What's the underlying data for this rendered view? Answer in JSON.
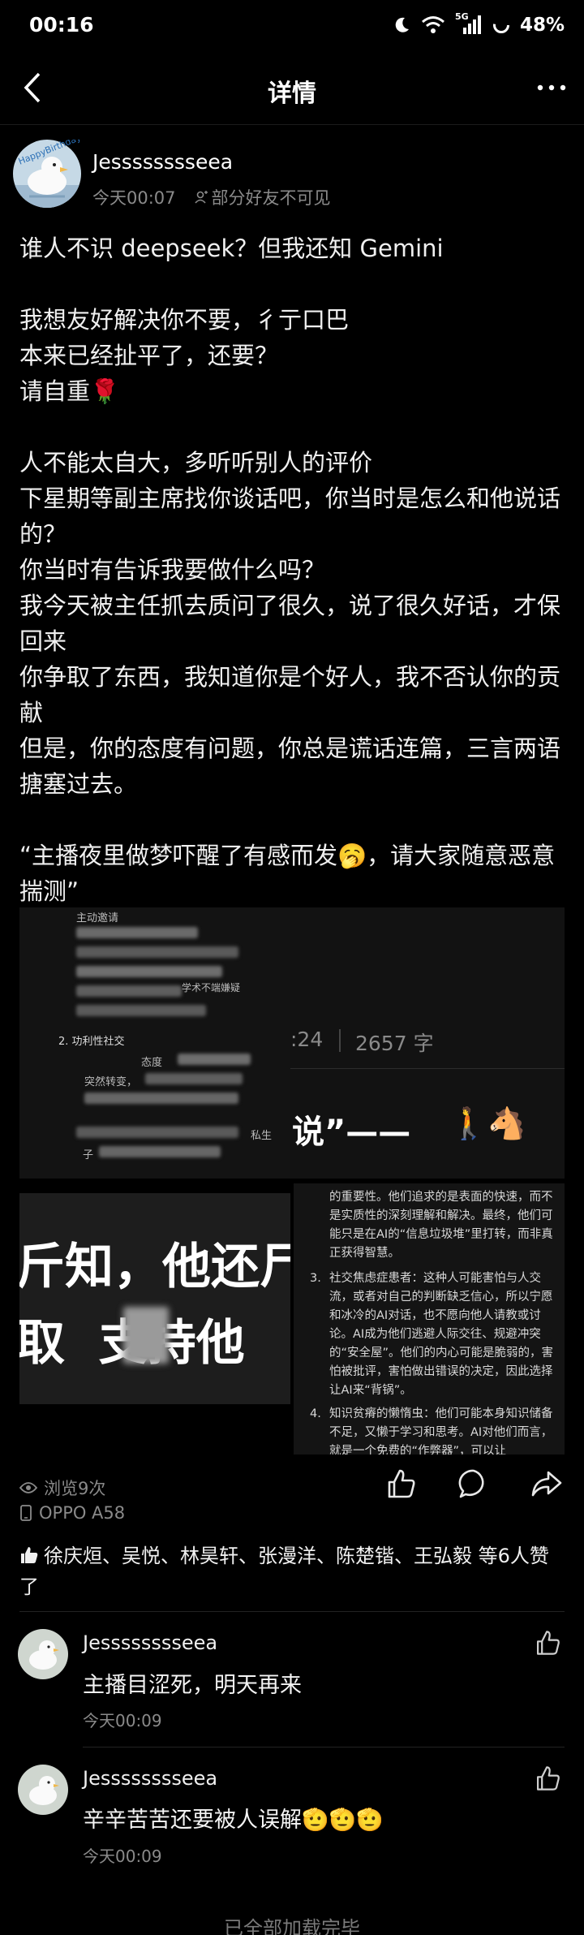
{
  "status_bar": {
    "time": "00:16",
    "network": "5G",
    "battery_text": "48%",
    "icons": [
      "moon-icon",
      "wifi-icon",
      "signal-icon",
      "battery-icon"
    ]
  },
  "nav": {
    "title": "详情",
    "back_icon": "chevron-left-icon",
    "more_icon": "more-dots-icon"
  },
  "post": {
    "author": "Jesssssssseea",
    "avatar_text": "HappyBirthday",
    "time": "今天00:07",
    "visibility": "部分好友不可见",
    "body": [
      "谁人不识 deepseek？但我还知 Gemini",
      "",
      "我想友好解决你不要，彳亍口巴",
      "本来已经扯平了，还要？",
      "请自重🌹",
      "",
      "人不能太自大，多听听别人的评价",
      "下星期等副主席找你谈话吧，你当时是怎么和他说话的？",
      "你当时有告诉我要做什么吗？",
      "我今天被主任抓去质问了很久，说了很久好话，才保回来",
      "你争取了东西，我知道你是个好人，我不否认你的贡献",
      "但是，你的态度有问题，你总是谎话连篇，三言两语搪塞过去。",
      "",
      "“主播夜里做梦吓醒了有感而发🥱，请大家随意恶意揣测”"
    ]
  },
  "media": {
    "img1": {
      "lines": [
        "主动邀请",
        "学术不端嫌疑",
        "2. 功利性社交",
        "态度",
        "突然转变，",
        "私生",
        "子"
      ]
    },
    "img2": {
      "stats": ":24",
      "word_count": "2657 字",
      "heading": "说”——",
      "emojis": "🚶🐴"
    },
    "img3": {
      "line1": "斤知，他还尸",
      "line2": "取  支持他"
    },
    "img4": {
      "p1": "的重要性。他们追求的是表面的快速，而不是实质性的深刻理解和解决。最终，他们可能只是在AI的“信息垃圾堆”里打转，而非真正获得智慧。",
      "item3_num": "3.",
      "item3": "社交焦虑症患者：这种人可能害怕与人交流，或者对自己的判断缺乏信心，所以宁愿和冰冷的AI对话，也不愿向他人请教或讨论。AI成为他们逃避人际交往、规避冲突的“安全屋”。他们的内心可能是脆弱的，害怕被批评，害怕做出错误的决定，因此选择让AI来“背锅”。",
      "item4_num": "4.",
      "item4": "知识贫瘠的懒惰虫：他们可能本身知识储备不足，又懒于学习和思考。AI对他们而言，就是一个免费的“作弊器”，可以让"
    }
  },
  "stats": {
    "views": "浏览9次",
    "device": "OPPO A58",
    "action_icons": [
      "thumb-up-icon",
      "comment-bubble-icon",
      "share-arrow-icon"
    ]
  },
  "likes": {
    "text": "徐庆烜、吴悦、林昊轩、张漫洋、陈楚锴、王弘毅 等6人赞了"
  },
  "comments": [
    {
      "name": "Jesssssssseea",
      "text": "主播目涩死，明天再来",
      "time": "今天00:09"
    },
    {
      "name": "Jesssssssseea",
      "text": "辛辛苦苦还要被人误解🫡🫡🫡",
      "time": "今天00:09"
    }
  ],
  "footer": {
    "text": "已全部加载完毕"
  }
}
